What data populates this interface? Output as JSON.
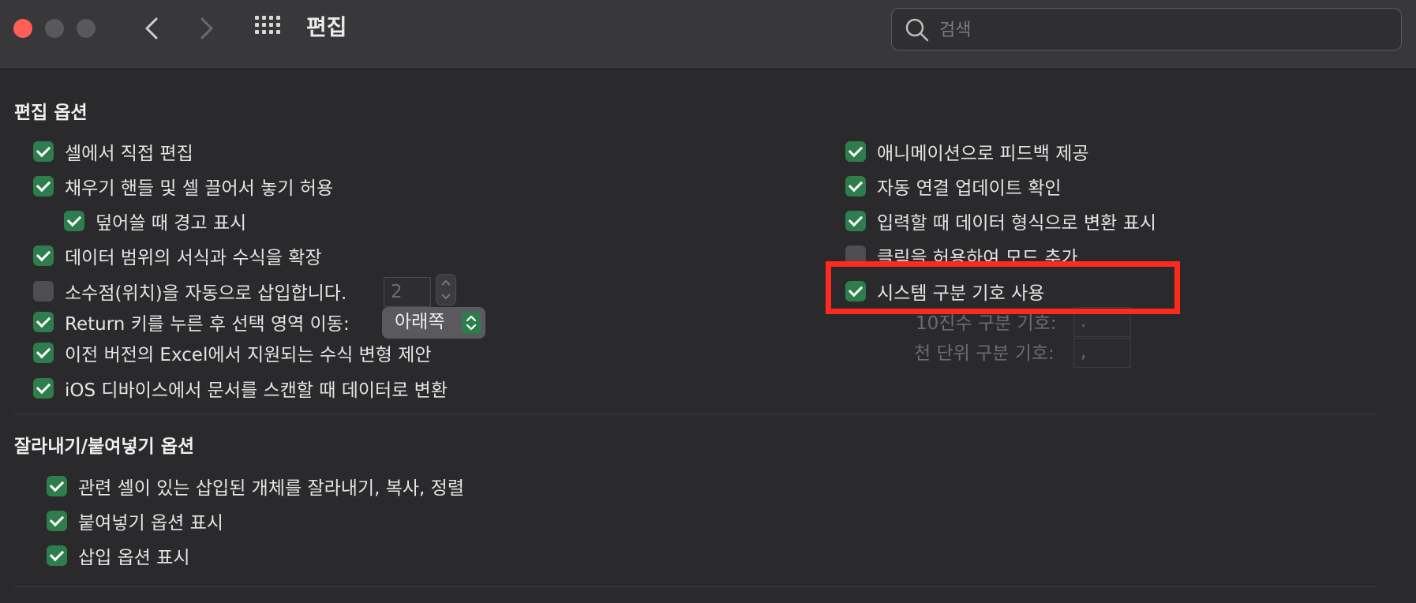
{
  "window": {
    "title": "편집",
    "search_placeholder": "검색"
  },
  "edit_options": {
    "title": "편집 옵션",
    "left": [
      {
        "label": "셀에서 직접 편집",
        "checked": true
      },
      {
        "label": "채우기 핸들 및 셀 끌어서 놓기 허용",
        "checked": true
      },
      {
        "label": "덮어쓸 때 경고 표시",
        "checked": true
      },
      {
        "label": "데이터 범위의 서식과 수식을 확장",
        "checked": true
      },
      {
        "label": "소수점(위치)을 자동으로 삽입합니다.",
        "checked": false,
        "value": "2"
      },
      {
        "label": "Return 키를 누른 후 선택 영역 이동:",
        "checked": true,
        "popup": "아래쪽"
      },
      {
        "label": "이전 버전의 Excel에서 지원되는 수식 변형 제안",
        "checked": true
      },
      {
        "label": "iOS 디바이스에서 문서를 스캔할 때 데이터로 변환",
        "checked": true
      }
    ],
    "right": [
      {
        "label": "애니메이션으로 피드백 제공",
        "checked": true
      },
      {
        "label": "자동 연결 업데이트 확인",
        "checked": true
      },
      {
        "label": "입력할 때 데이터 형식으로 변환 표시",
        "checked": true
      },
      {
        "label": "클릭을 허용하여 모드 추가",
        "checked": false
      },
      {
        "label": "시스템 구분 기호 사용",
        "checked": true
      }
    ],
    "decimal_separator": {
      "label": "10진수 구분 기호:",
      "value": "."
    },
    "thousands_separator": {
      "label": "천 단위 구분 기호:",
      "value": ","
    }
  },
  "cut_paste_options": {
    "title": "잘라내기/붙여넣기 옵션",
    "items": [
      {
        "label": "관련 셀이 있는 삽입된 개체를 잘라내기, 복사, 정렬",
        "checked": true
      },
      {
        "label": "붙여넣기 옵션 표시",
        "checked": true
      },
      {
        "label": "삽입 옵션 표시",
        "checked": true
      }
    ]
  },
  "colors": {
    "checkbox_on": "#2e7d4c",
    "highlight_box": "#ff2a1d"
  }
}
